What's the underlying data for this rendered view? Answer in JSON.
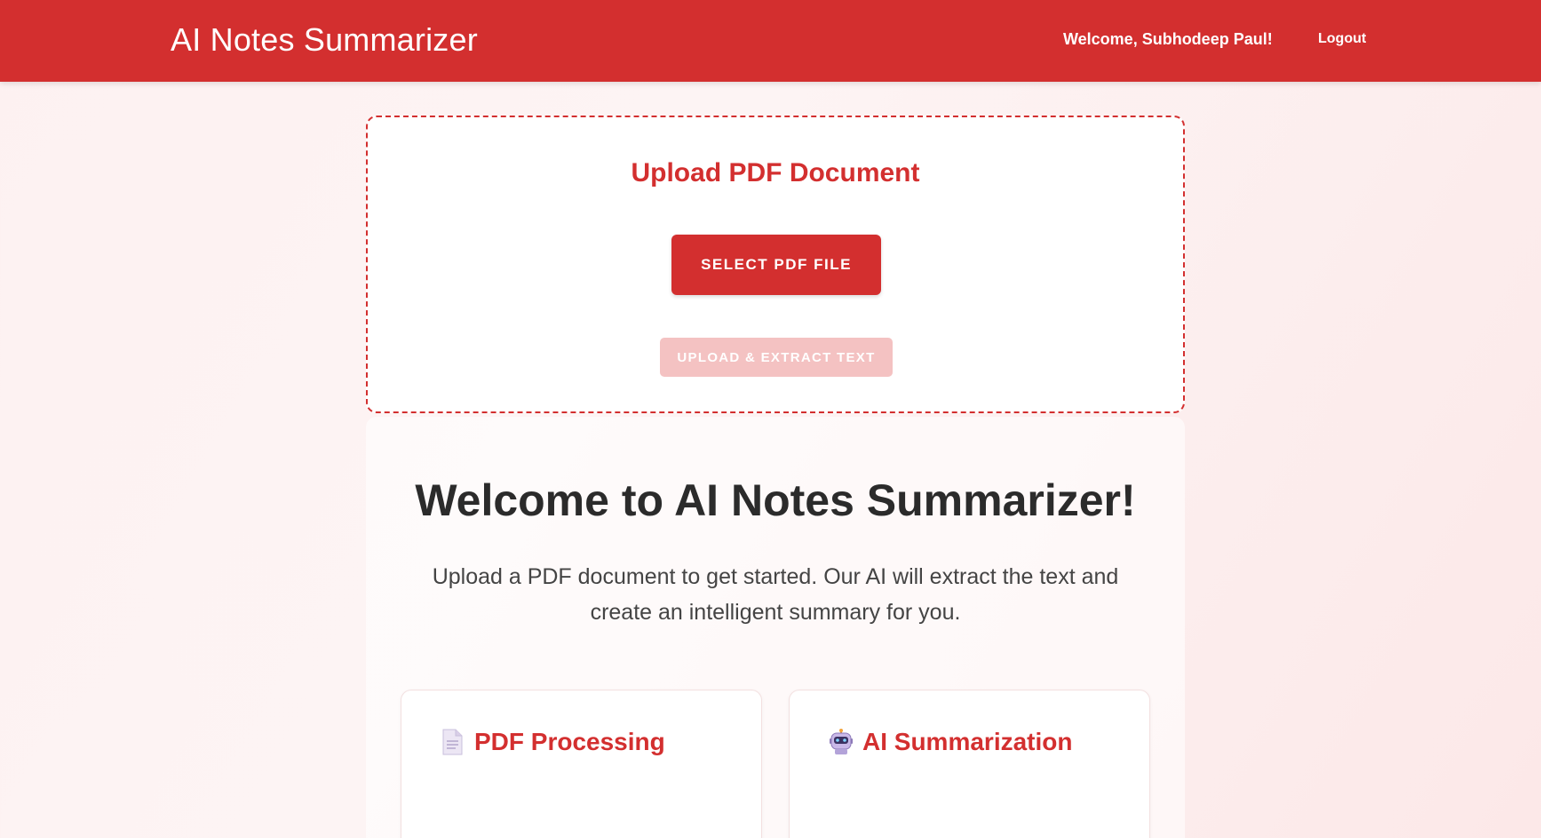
{
  "navbar": {
    "brand": "AI Notes Summarizer",
    "welcome": "Welcome, Subhodeep Paul!",
    "logout": "Logout"
  },
  "upload": {
    "title": "Upload PDF Document",
    "select_button": "SELECT PDF FILE",
    "upload_button": "UPLOAD & EXTRACT TEXT"
  },
  "welcome": {
    "heading": "Welcome to AI Notes Summarizer!",
    "description": "Upload a PDF document to get started. Our AI will extract the text and create an intelligent summary for you."
  },
  "features": [
    {
      "icon": "document-icon",
      "title": "PDF Processing"
    },
    {
      "icon": "robot-icon",
      "title": "AI Summarization"
    }
  ],
  "colors": {
    "primary": "#d32f2f",
    "disabled": "#f4c2c2"
  }
}
